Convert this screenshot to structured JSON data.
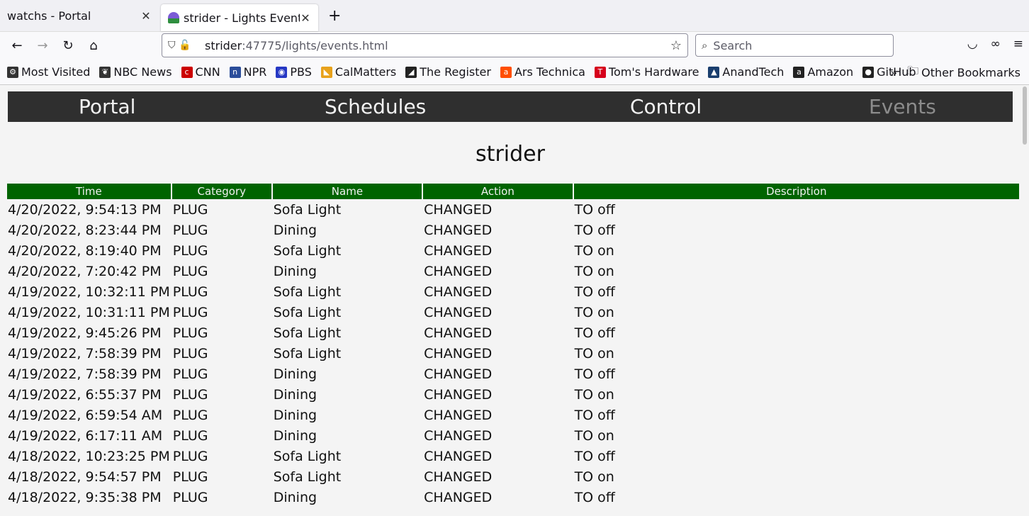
{
  "tabs": [
    {
      "title": "watchs - Portal"
    },
    {
      "title": "strider - Lights Events"
    }
  ],
  "url": {
    "host": "strider",
    "path": ":47775/lights/events.html"
  },
  "search": {
    "placeholder": "Search"
  },
  "bookmarks": [
    {
      "label": "Most Visited",
      "icon": "gear-icon",
      "color": "#333333"
    },
    {
      "label": "NBC News",
      "icon": "peacock-icon",
      "color": "#333333"
    },
    {
      "label": "CNN",
      "icon": "cnn-icon",
      "color": "#cc0000"
    },
    {
      "label": "NPR",
      "icon": "npr-icon",
      "color": "#2b4d9a"
    },
    {
      "label": "PBS",
      "icon": "pbs-icon",
      "color": "#2638c4"
    },
    {
      "label": "CalMatters",
      "icon": "calmatters-icon",
      "color": "#e8a21c"
    },
    {
      "label": "The Register",
      "icon": "register-icon",
      "color": "#222222"
    },
    {
      "label": "Ars Technica",
      "icon": "ars-icon",
      "color": "#ff4e00"
    },
    {
      "label": "Tom's Hardware",
      "icon": "toms-icon",
      "color": "#d6001c"
    },
    {
      "label": "AnandTech",
      "icon": "anandtech-icon",
      "color": "#1a3e6e"
    },
    {
      "label": "Amazon",
      "icon": "amazon-icon",
      "color": "#222222"
    },
    {
      "label": "GitHub",
      "icon": "github-icon",
      "color": "#222222"
    }
  ],
  "other_bookmarks": "Other Bookmarks",
  "site_nav": [
    {
      "label": "Portal",
      "current": false
    },
    {
      "label": "Schedules",
      "current": false
    },
    {
      "label": "Control",
      "current": false
    },
    {
      "label": "Events",
      "current": true
    }
  ],
  "host_title": "strider",
  "table": {
    "headers": [
      "Time",
      "Category",
      "Name",
      "Action",
      "Description"
    ],
    "rows": [
      [
        "4/20/2022, 9:54:13 PM",
        "PLUG",
        "Sofa Light",
        "CHANGED",
        "TO off"
      ],
      [
        "4/20/2022, 8:23:44 PM",
        "PLUG",
        "Dining",
        "CHANGED",
        "TO off"
      ],
      [
        "4/20/2022, 8:19:40 PM",
        "PLUG",
        "Sofa Light",
        "CHANGED",
        "TO on"
      ],
      [
        "4/20/2022, 7:20:42 PM",
        "PLUG",
        "Dining",
        "CHANGED",
        "TO on"
      ],
      [
        "4/19/2022, 10:32:11 PM",
        "PLUG",
        "Sofa Light",
        "CHANGED",
        "TO off"
      ],
      [
        "4/19/2022, 10:31:11 PM",
        "PLUG",
        "Sofa Light",
        "CHANGED",
        "TO on"
      ],
      [
        "4/19/2022, 9:45:26 PM",
        "PLUG",
        "Sofa Light",
        "CHANGED",
        "TO off"
      ],
      [
        "4/19/2022, 7:58:39 PM",
        "PLUG",
        "Sofa Light",
        "CHANGED",
        "TO on"
      ],
      [
        "4/19/2022, 7:58:39 PM",
        "PLUG",
        "Dining",
        "CHANGED",
        "TO off"
      ],
      [
        "4/19/2022, 6:55:37 PM",
        "PLUG",
        "Dining",
        "CHANGED",
        "TO on"
      ],
      [
        "4/19/2022, 6:59:54 AM",
        "PLUG",
        "Dining",
        "CHANGED",
        "TO off"
      ],
      [
        "4/19/2022, 6:17:11 AM",
        "PLUG",
        "Dining",
        "CHANGED",
        "TO on"
      ],
      [
        "4/18/2022, 10:23:25 PM",
        "PLUG",
        "Sofa Light",
        "CHANGED",
        "TO off"
      ],
      [
        "4/18/2022, 9:54:57 PM",
        "PLUG",
        "Sofa Light",
        "CHANGED",
        "TO on"
      ],
      [
        "4/18/2022, 9:35:38 PM",
        "PLUG",
        "Dining",
        "CHANGED",
        "TO off"
      ]
    ]
  }
}
